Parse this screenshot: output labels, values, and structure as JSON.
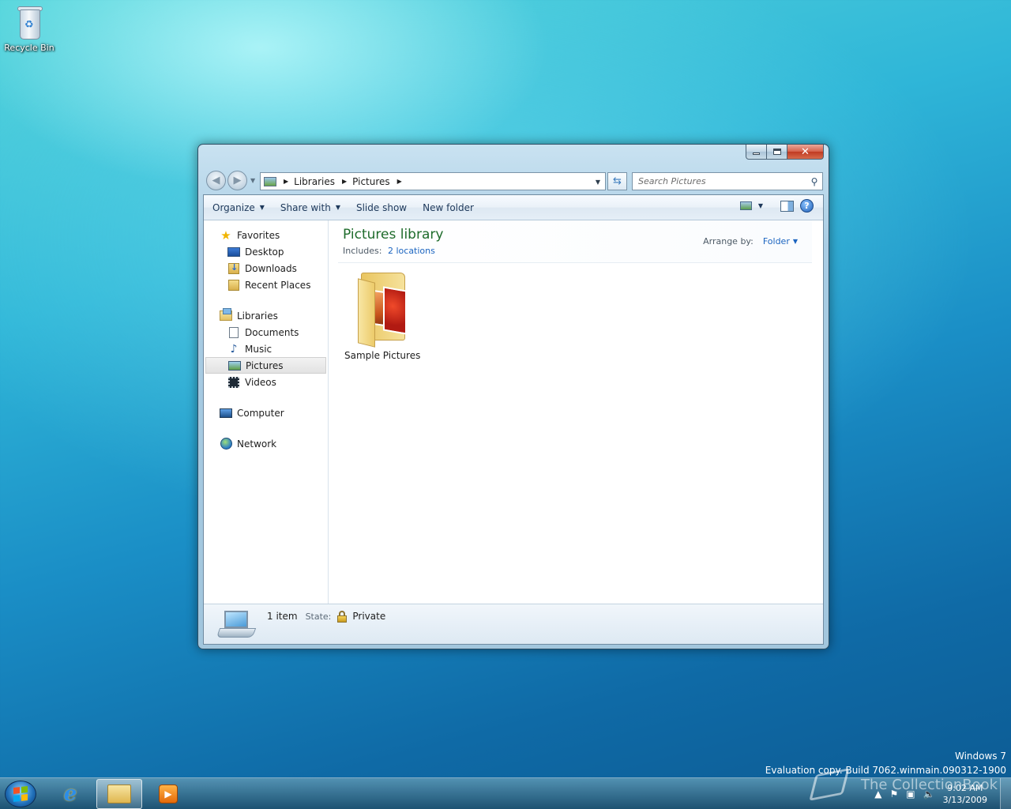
{
  "desktop": {
    "recycle_bin_label": "Recycle Bin",
    "watermark_line1": "Windows 7",
    "watermark_line2": "Evaluation copy. Build 7062.winmain.090312-1900",
    "brand_text": "The CollectionBook"
  },
  "window": {
    "caption_buttons": {
      "minimize": "minimize",
      "maximize": "maximize",
      "close": "✕"
    },
    "breadcrumb": [
      "Libraries",
      "Pictures"
    ],
    "search_placeholder": "Search Pictures",
    "toolbar": {
      "organize": "Organize",
      "share_with": "Share with",
      "slide_show": "Slide show",
      "new_folder": "New folder"
    },
    "nav": {
      "favorites": {
        "label": "Favorites",
        "items": [
          "Desktop",
          "Downloads",
          "Recent Places"
        ]
      },
      "libraries": {
        "label": "Libraries",
        "items": [
          "Documents",
          "Music",
          "Pictures",
          "Videos"
        ],
        "selected": "Pictures"
      },
      "computer": "Computer",
      "network": "Network"
    },
    "library": {
      "title": "Pictures library",
      "includes_label": "Includes:",
      "includes_link": "2 locations",
      "arrange_label": "Arrange by:",
      "arrange_value": "Folder"
    },
    "items": [
      {
        "name": "Sample Pictures",
        "type": "folder"
      }
    ],
    "details": {
      "count": "1 item",
      "state_label": "State:",
      "state_value": "Private"
    }
  },
  "taskbar": {
    "clock_time": "9:02 AM",
    "clock_date": "3/13/2009"
  },
  "colors": {
    "library_title": "#1e6b2b",
    "link": "#1b64c0",
    "close_button": "#c03a22"
  }
}
